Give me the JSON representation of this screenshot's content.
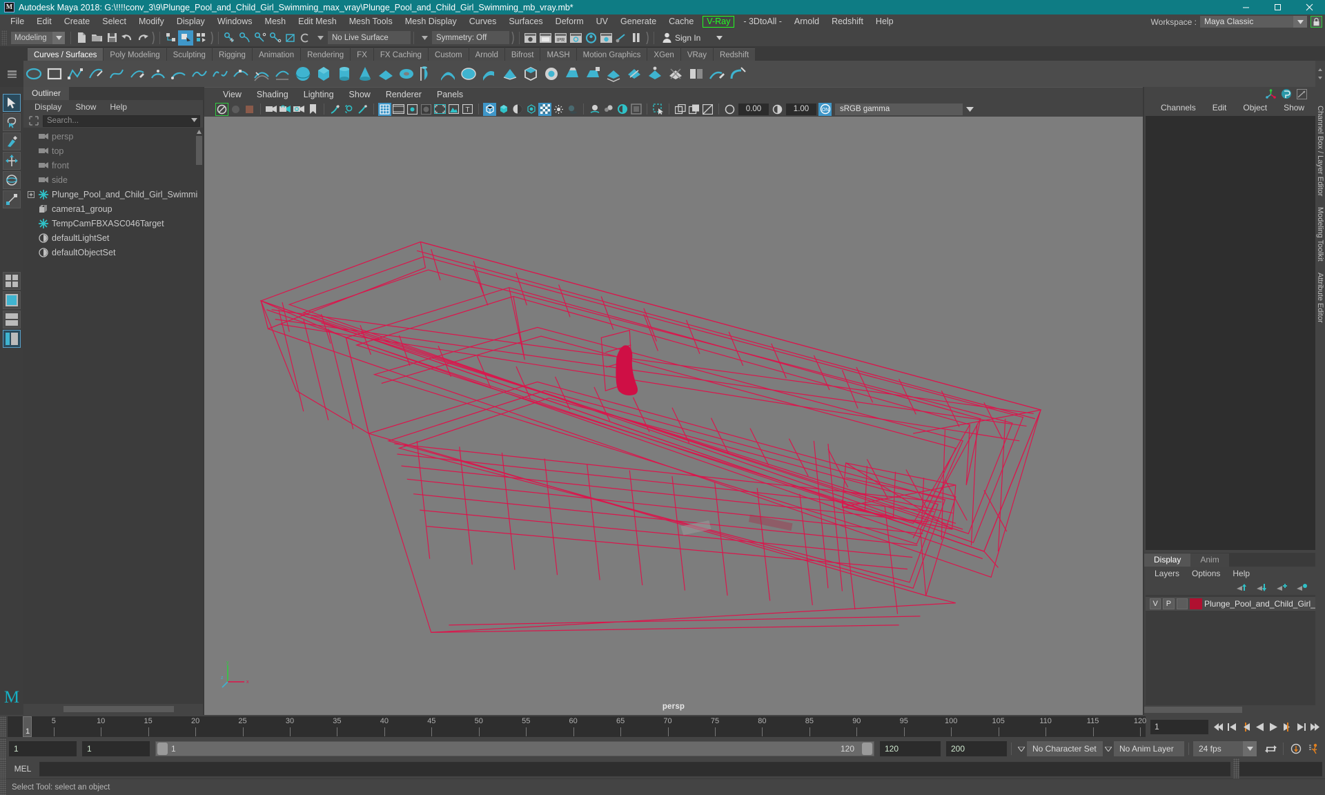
{
  "titlebar": {
    "app_icon": "maya-logo-icon",
    "title": "Autodesk Maya 2018: G:\\!!!!conv_3\\9\\Plunge_Pool_and_Child_Girl_Swimming_max_vray\\Plunge_Pool_and_Child_Girl_Swimming_mb_vray.mb*",
    "minimize": "minimize-icon",
    "maximize": "maximize-icon",
    "close": "close-icon",
    "bg_color": "#0e7c84"
  },
  "menubar": {
    "items": [
      {
        "label": "File"
      },
      {
        "label": "Edit"
      },
      {
        "label": "Create"
      },
      {
        "label": "Select"
      },
      {
        "label": "Modify"
      },
      {
        "label": "Display"
      },
      {
        "label": "Windows"
      },
      {
        "label": "Mesh"
      },
      {
        "label": "Edit Mesh"
      },
      {
        "label": "Mesh Tools"
      },
      {
        "label": "Mesh Display"
      },
      {
        "label": "Curves"
      },
      {
        "label": "Surfaces"
      },
      {
        "label": "Deform"
      },
      {
        "label": "UV"
      },
      {
        "label": "Generate"
      },
      {
        "label": "Cache"
      }
    ],
    "highlight": {
      "label": "V-Ray",
      "color": "#22ff22"
    },
    "after_highlight": [
      {
        "label": "- 3DtoAll -"
      },
      {
        "label": "Arnold"
      },
      {
        "label": "Redshift"
      },
      {
        "label": "Help"
      }
    ],
    "workspace_label": "Workspace :",
    "workspace_value": "Maya Classic",
    "workspace_lock_icon": "lock-icon",
    "workspace_arrow_icon": "chevron-down-icon"
  },
  "statusline": {
    "mode_value": "Modeling",
    "live_surface_value": "No Live Surface",
    "symmetry_value": "Symmetry: Off",
    "signin_label": "Sign In",
    "signin_icon": "person-icon",
    "signin_arrow_icon": "chevron-down-icon"
  },
  "shelf": {
    "tabs": [
      {
        "label": "Curves / Surfaces",
        "active": true
      },
      {
        "label": "Poly Modeling",
        "active": false
      },
      {
        "label": "Sculpting",
        "active": false
      },
      {
        "label": "Rigging",
        "active": false
      },
      {
        "label": "Animation",
        "active": false
      },
      {
        "label": "Rendering",
        "active": false
      },
      {
        "label": "FX",
        "active": false
      },
      {
        "label": "FX Caching",
        "active": false
      },
      {
        "label": "Custom",
        "active": false
      },
      {
        "label": "Arnold",
        "active": false
      },
      {
        "label": "Bifrost",
        "active": false
      },
      {
        "label": "MASH",
        "active": false
      },
      {
        "label": "Motion Graphics",
        "active": false
      },
      {
        "label": "XGen",
        "active": false
      },
      {
        "label": "VRay",
        "active": false
      },
      {
        "label": "Redshift",
        "active": false
      }
    ]
  },
  "outliner": {
    "tab_label": "Outliner",
    "menus": [
      {
        "label": "Display"
      },
      {
        "label": "Show"
      },
      {
        "label": "Help"
      }
    ],
    "search_placeholder": "Search...",
    "search_value": "",
    "items": [
      {
        "label": "persp",
        "icon": "camera-icon",
        "dim": true,
        "expandable": false
      },
      {
        "label": "top",
        "icon": "camera-icon",
        "dim": true,
        "expandable": false
      },
      {
        "label": "front",
        "icon": "camera-icon",
        "dim": true,
        "expandable": false
      },
      {
        "label": "side",
        "icon": "camera-icon",
        "dim": true,
        "expandable": false
      },
      {
        "label": "Plunge_Pool_and_Child_Girl_Swimmi",
        "icon": "transform-icon",
        "dim": false,
        "expandable": true
      },
      {
        "label": "camera1_group",
        "icon": "group-icon",
        "dim": false,
        "expandable": false
      },
      {
        "label": "TempCamFBXASC046Target",
        "icon": "transform-icon",
        "dim": false,
        "expandable": false
      },
      {
        "label": "defaultLightSet",
        "icon": "set-icon",
        "dim": false,
        "expandable": false
      },
      {
        "label": "defaultObjectSet",
        "icon": "set-icon",
        "dim": false,
        "expandable": false
      }
    ]
  },
  "viewport": {
    "menus": [
      {
        "label": "View"
      },
      {
        "label": "Shading"
      },
      {
        "label": "Lighting"
      },
      {
        "label": "Show"
      },
      {
        "label": "Renderer"
      },
      {
        "label": "Panels"
      }
    ],
    "exposure_value": "0.00",
    "gamma_value": "1.00",
    "color_management": "sRGB gamma",
    "camera_label": "persp",
    "background_color": "#7d7d7d",
    "wireframe_color": "#e0114a",
    "axis_labels": {
      "x": "x",
      "y": "y",
      "z": "z"
    }
  },
  "channelbox": {
    "menus": [
      {
        "label": "Channels"
      },
      {
        "label": "Edit"
      },
      {
        "label": "Object"
      },
      {
        "label": "Show"
      }
    ],
    "icons": [
      "axis-icon",
      "channel-box-icon",
      "graph-icon"
    ],
    "vertical_tabs": [
      "Channel Box / Layer Editor",
      "Modeling Toolkit",
      "Attribute Editor"
    ]
  },
  "layereditor": {
    "tabs": [
      {
        "label": "Display",
        "active": true
      },
      {
        "label": "Anim",
        "active": false
      }
    ],
    "menus": [
      {
        "label": "Layers"
      },
      {
        "label": "Options"
      },
      {
        "label": "Help"
      }
    ],
    "buttons": [
      "move-layer-up-icon",
      "move-layer-down-icon",
      "new-layer-from-selected-icon",
      "new-layer-icon"
    ],
    "layers": [
      {
        "visibility": "V",
        "playback": "P",
        "shading": "",
        "color": "#b01030",
        "name": "Plunge_Pool_and_Child_Girl_S"
      }
    ]
  },
  "timeslider": {
    "current_frame": "1",
    "start": 1,
    "end": 120,
    "tick_labels": [
      5,
      10,
      15,
      20,
      25,
      30,
      35,
      40,
      45,
      50,
      55,
      60,
      65,
      70,
      75,
      80,
      85,
      90,
      95,
      100,
      105,
      110,
      115,
      120
    ],
    "frame_field": "1",
    "playback_buttons": [
      "go-to-start-icon",
      "step-back-key-icon",
      "step-back-frame-icon",
      "play-backwards-icon",
      "play-forwards-icon",
      "step-forward-frame-icon",
      "step-forward-key-icon",
      "go-to-end-icon"
    ]
  },
  "rangeslider": {
    "anim_start": "1",
    "range_start": "1",
    "bar_start_label": "1",
    "bar_end_label": "120",
    "range_end": "120",
    "anim_end": "200",
    "character_set": "No Character Set",
    "anim_layer": "No Anim Layer",
    "fps": "24 fps",
    "loop_icon": "loop-icon",
    "auto_key_icon": "auto-key-icon",
    "anim_prefs_icon": "animation-preferences-icon"
  },
  "commandline": {
    "label": "MEL",
    "input_value": "",
    "output_value": ""
  },
  "helpline": {
    "text": "Select Tool: select an object"
  }
}
